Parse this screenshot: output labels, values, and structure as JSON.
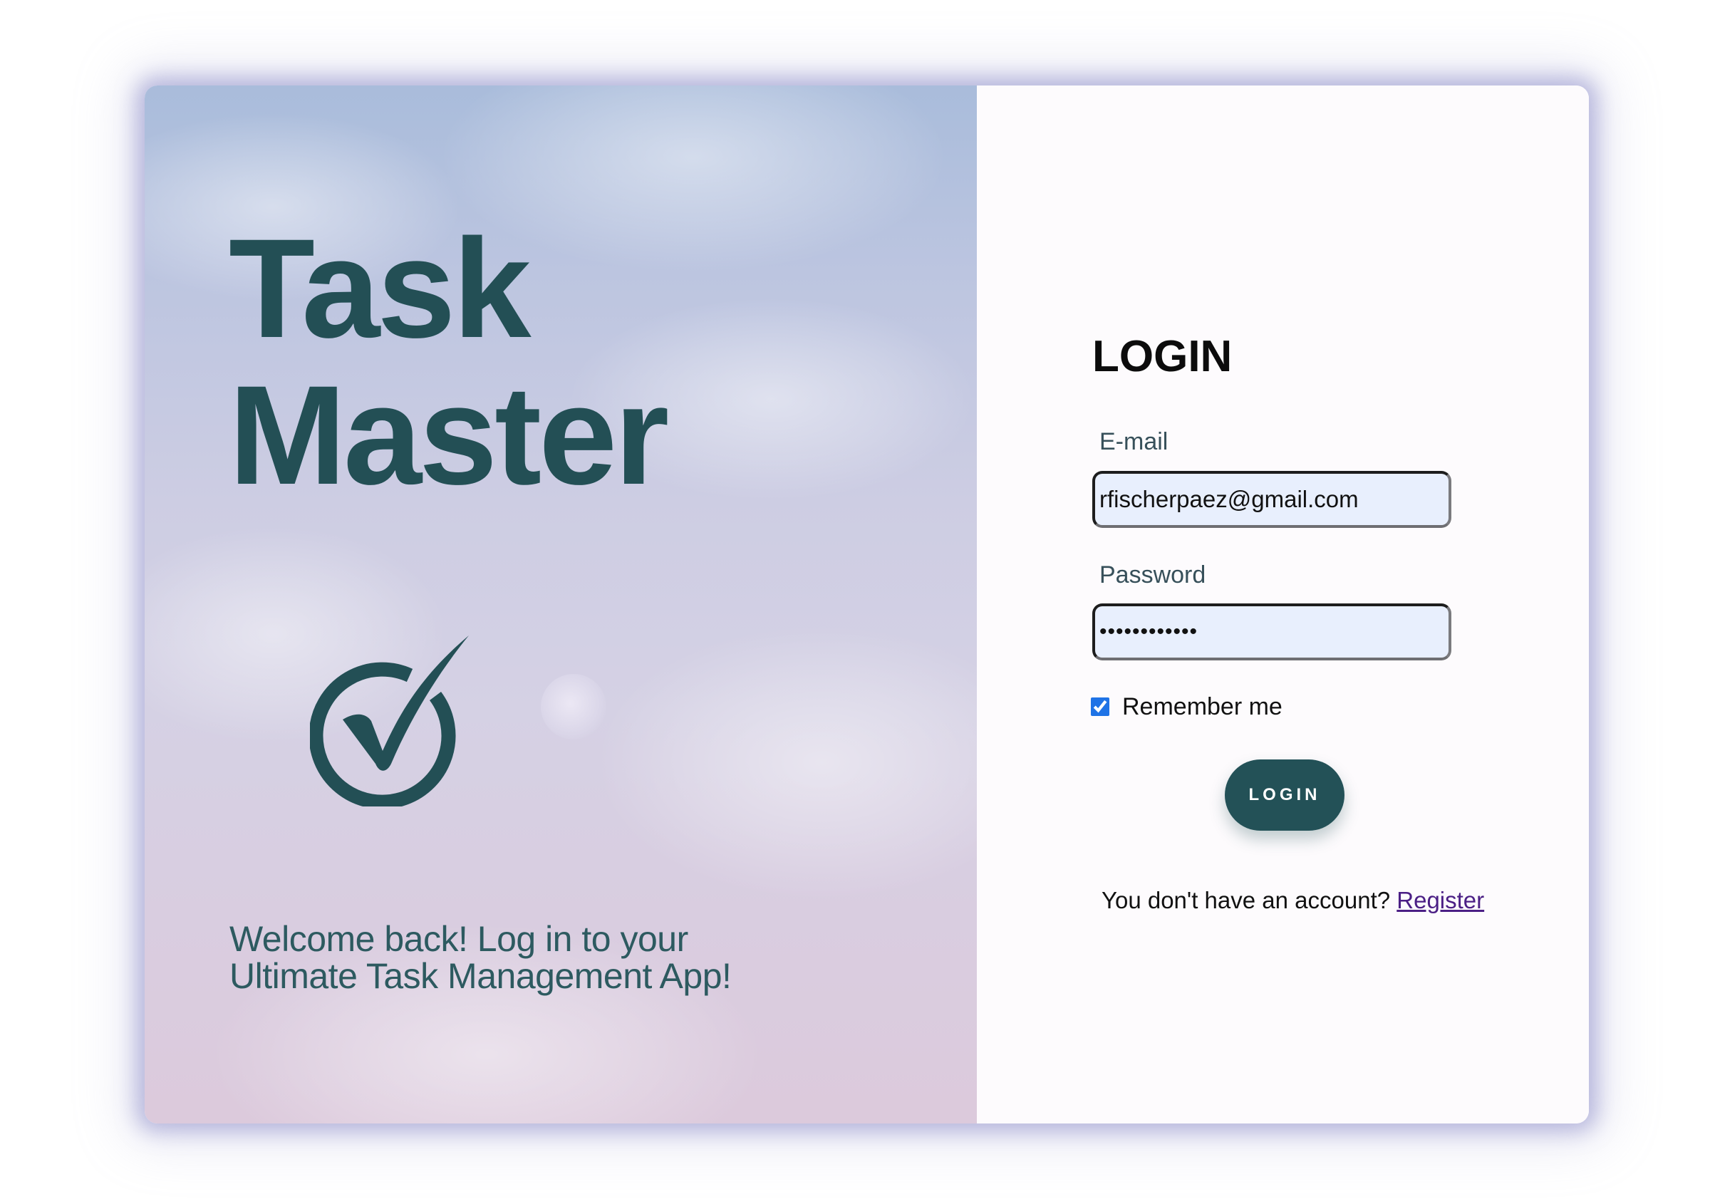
{
  "brand": {
    "title_line1": "Task",
    "title_line2": "Master",
    "logo_icon": "check-circle-icon",
    "tagline_line1": "Welcome back! Log in to your",
    "tagline_line2": "Ultimate Task Management App!"
  },
  "login": {
    "title": "LOGIN",
    "email_label": "E-mail",
    "email_value": "rfischerpaez@gmail.com",
    "password_label": "Password",
    "password_value": "••••••••••••",
    "remember_label": "Remember me",
    "remember_checked": true,
    "submit_label": "LOGIN",
    "register_prompt": "You don't have an account?",
    "register_link": "Register"
  },
  "colors": {
    "brand": "#234f55",
    "input_bg": "#e8effd",
    "link": "#4b1f85",
    "checkbox": "#1f73e6"
  }
}
